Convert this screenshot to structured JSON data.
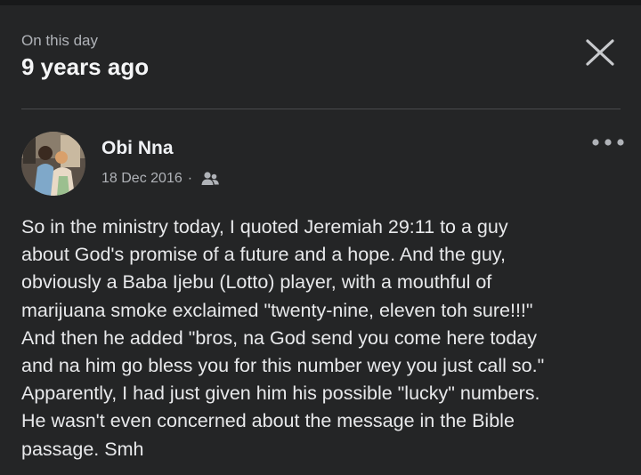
{
  "memory": {
    "label": "On this day",
    "title": "9 years ago"
  },
  "post": {
    "author": "Obi Nna",
    "date": "18 Dec 2016",
    "separator": "·",
    "audience_icon": "friends-icon",
    "text": "So in the ministry today, I quoted Jeremiah 29:11 to a guy\nabout God's promise of a future and a hope. And the guy,\nobviously a Baba Ijebu (Lotto) player, with a mouthful of\nmarijuana smoke exclaimed \"twenty-nine, eleven toh sure!!!\"\nAnd then he added \"bros, na God send you come here today\nand na him go bless you for this number wey you just call so.\"\nApparently, I had just given him his possible \"lucky\" numbers.\nHe wasn't even concerned about the message in the Bible\npassage. Smh"
  },
  "icons": {
    "close": "close-icon",
    "more": "more-options-icon",
    "avatar": "profile-photo"
  },
  "colors": {
    "background": "#242526",
    "text_primary": "#e4e6eb",
    "text_secondary": "#b0b3b8",
    "divider": "#4a4b4d"
  }
}
